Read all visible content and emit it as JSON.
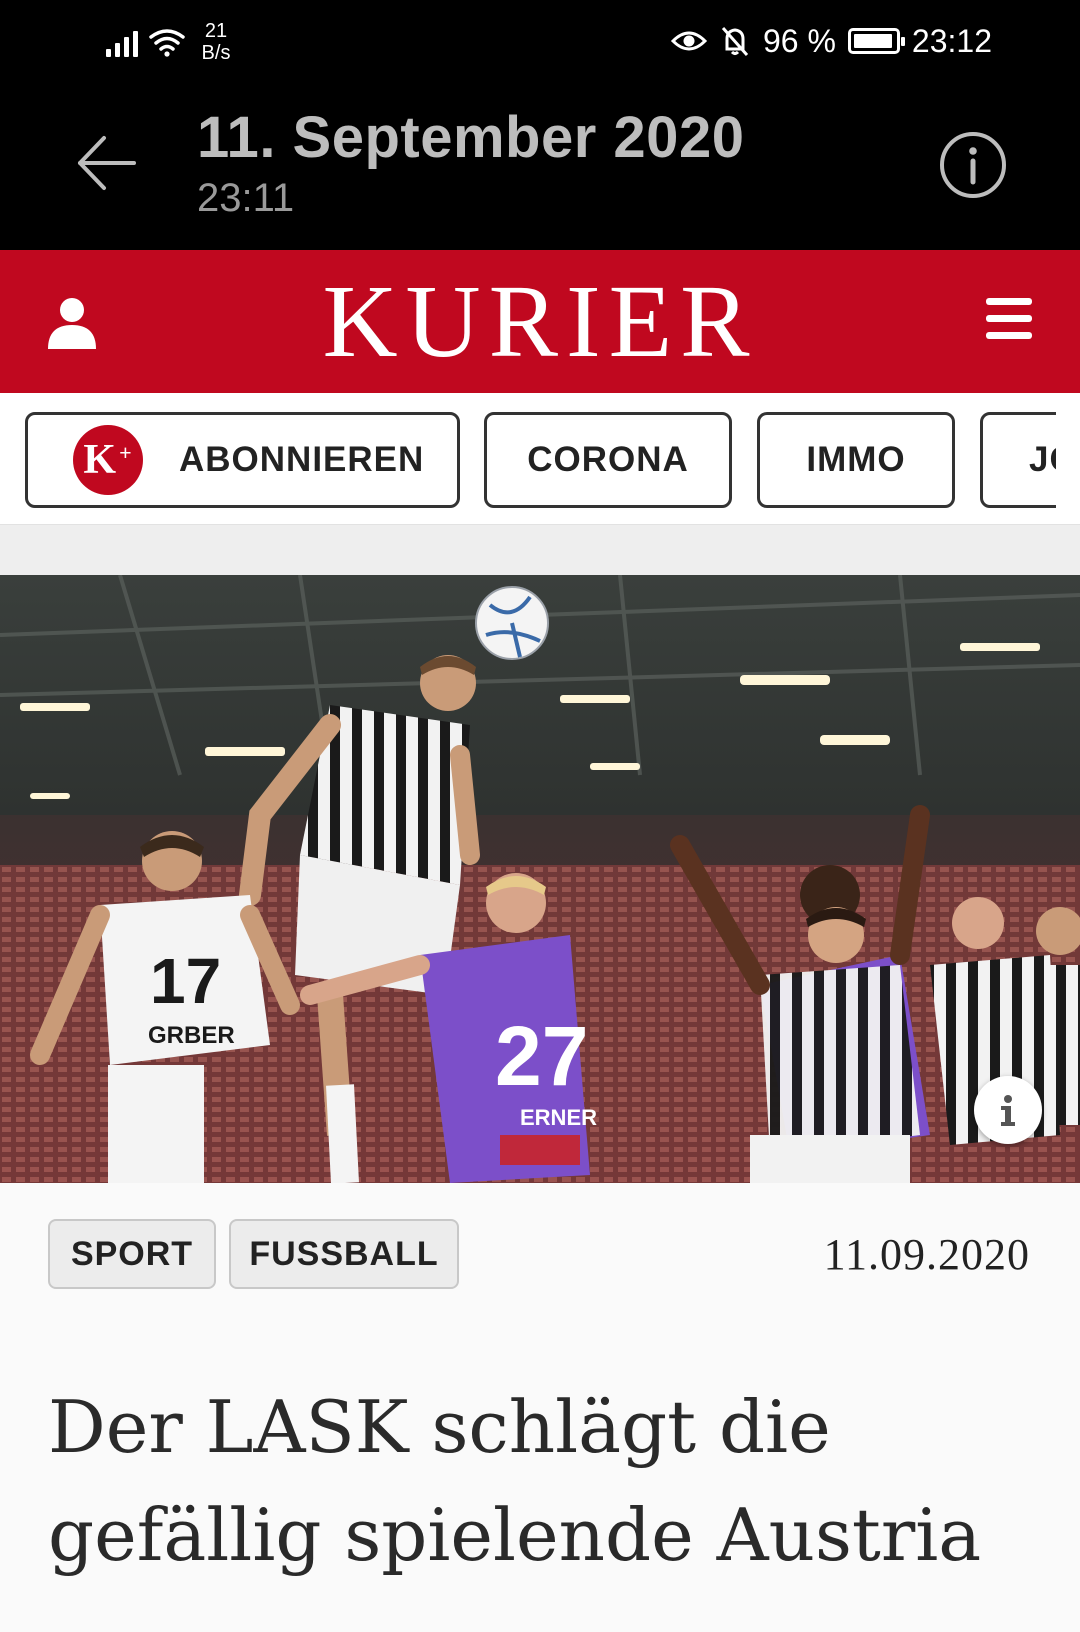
{
  "status_bar": {
    "net_speed_value": "21",
    "net_speed_unit": "B/s",
    "battery_percent": "96 %",
    "battery_level": 0.96,
    "clock": "23:12",
    "icons": [
      "signal-icon",
      "wifi-icon",
      "eye-icon",
      "bell-off-icon",
      "battery-icon"
    ]
  },
  "viewer": {
    "date": "11. September 2020",
    "time": "23:11"
  },
  "header": {
    "brand": "KURIER"
  },
  "nav": {
    "chips": [
      {
        "label": "ABONNIEREN",
        "badge": "K",
        "badge_sup": "+"
      },
      {
        "label": "CORONA"
      },
      {
        "label": "IMMO"
      },
      {
        "label": "JO"
      }
    ]
  },
  "photo": {
    "jersey_numbers": [
      "17",
      "27"
    ],
    "player_names": [
      "GRBER",
      "ERNER"
    ]
  },
  "article": {
    "tags": [
      "SPORT",
      "FUSSBALL"
    ],
    "date": "11.09.2020",
    "headline": "Der LASK schlägt die gefällig spielende Austria"
  },
  "colors": {
    "brand_red": "#c0081f",
    "status_bg": "#000000",
    "tag_bg": "#ececec",
    "text": "#2a2a2a"
  }
}
